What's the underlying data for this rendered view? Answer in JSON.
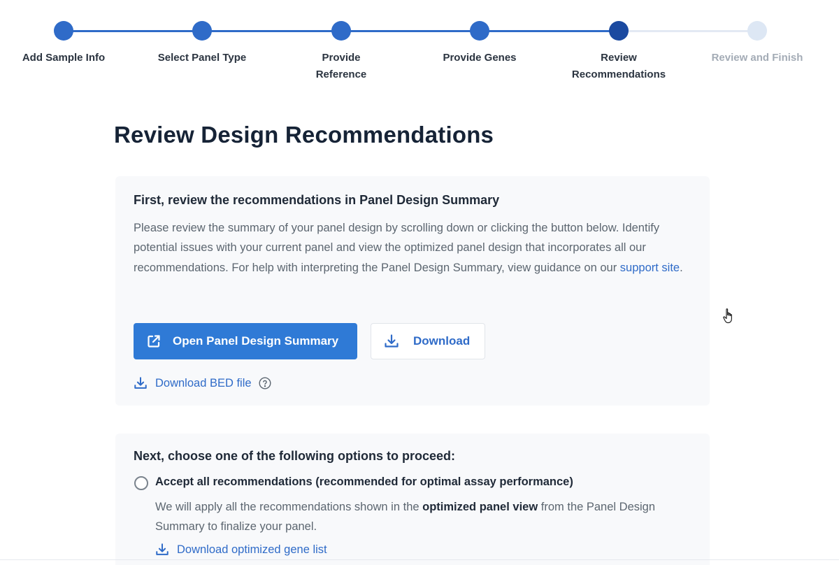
{
  "stepper": {
    "steps": [
      {
        "label": "Add Sample Info",
        "state": "done"
      },
      {
        "label": "Select Panel Type",
        "state": "done"
      },
      {
        "label": "Provide Reference",
        "state": "done"
      },
      {
        "label": "Provide Genes",
        "state": "done"
      },
      {
        "label": "Review Recommendations",
        "state": "current"
      },
      {
        "label": "Review and Finish",
        "state": "future"
      }
    ]
  },
  "page": {
    "title": "Review Design Recommendations"
  },
  "review_card": {
    "heading": "First, review the recommendations in Panel Design Summary",
    "body_text": "Please review the summary of your panel design by scrolling down or clicking the button below. Identify potential issues with your current panel and view the optimized panel design that incorporates all our recommendations. For help with interpreting the Panel Design Summary, view guidance on our ",
    "support_link": "support site",
    "body_end": ".",
    "open_summary_button": "Open Panel Design Summary",
    "download_button": "Download",
    "download_bed_link": "Download BED file"
  },
  "options_card": {
    "heading": "Next, choose one of the following options to proceed:",
    "accept_option": {
      "label": "Accept all recommendations (recommended for optimal assay performance)",
      "desc_prefix": "We will apply all the recommendations shown in the ",
      "desc_bold": "optimized panel view",
      "desc_suffix": " from the Panel Design Summary to finalize your panel.",
      "link": "Download optimized gene list"
    }
  },
  "icons": {
    "open_external": "external-link-icon",
    "download": "download-icon",
    "help": "help-circle-icon",
    "cursor": "hand-pointer-cursor"
  },
  "colors": {
    "primary": "#2f7ad6",
    "step_done": "#2f6bc8",
    "step_current": "#1b4aa0",
    "step_future": "#dde7f4",
    "link": "#2f6bc8"
  }
}
